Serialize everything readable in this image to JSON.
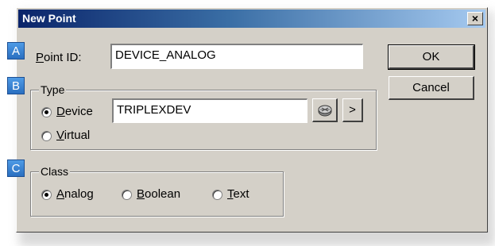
{
  "window": {
    "title": "New Point",
    "close_glyph": "×"
  },
  "markers": {
    "a": "A",
    "b": "B",
    "c": "C"
  },
  "point_id": {
    "label_accel": "P",
    "label_rest": "oint ID:",
    "value": "DEVICE_ANALOG"
  },
  "type_group": {
    "legend": "Type",
    "device": {
      "accel": "D",
      "rest": "evice",
      "selected": true
    },
    "device_value": "TRIPLEXDEV",
    "browse_icon": "device-browse-icon",
    "more_label": ">",
    "virtual": {
      "accel": "V",
      "rest": "irtual",
      "selected": false
    }
  },
  "class_group": {
    "legend": "Class",
    "options": [
      {
        "accel": "A",
        "rest": "nalog",
        "selected": true
      },
      {
        "accel": "B",
        "rest": "oolean",
        "selected": false
      },
      {
        "accel": "T",
        "rest": "ext",
        "selected": false
      }
    ]
  },
  "buttons": {
    "ok": "OK",
    "cancel": "Cancel"
  },
  "colors": {
    "title_start": "#0a246a",
    "title_end": "#a6caf0",
    "face": "#d4d0c8",
    "marker": "#2a6fc0"
  }
}
